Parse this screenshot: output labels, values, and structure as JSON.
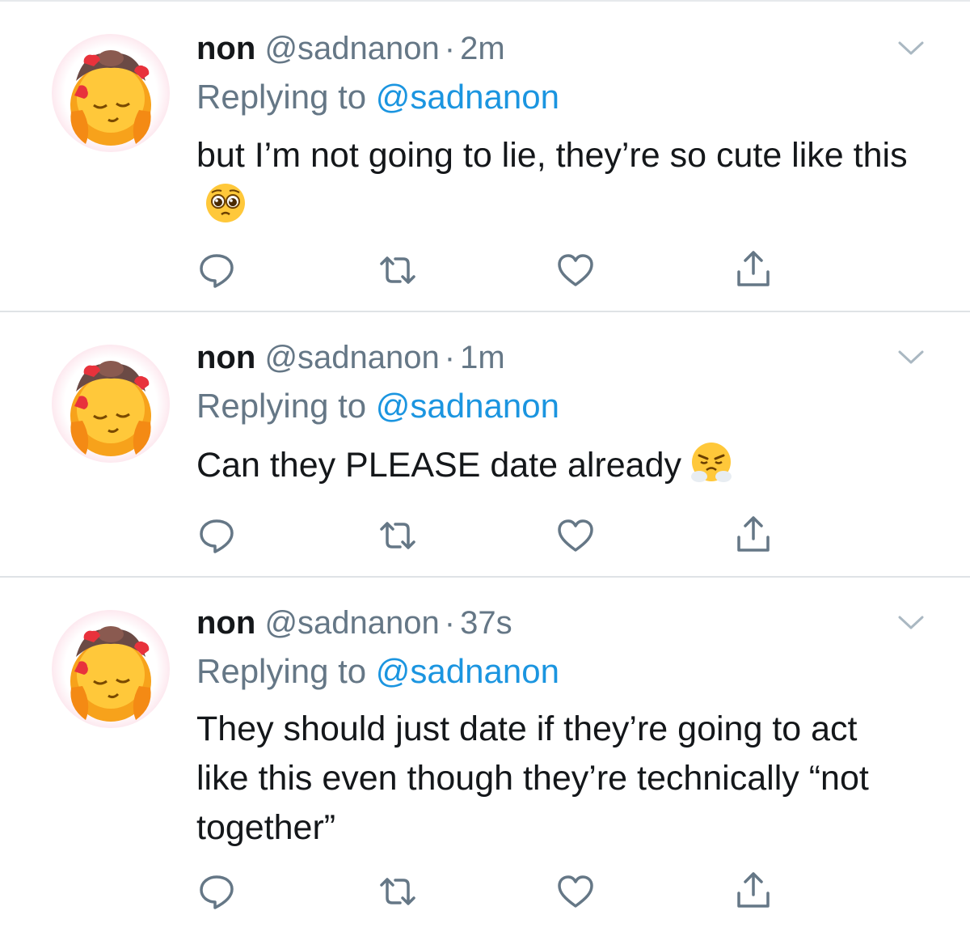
{
  "tweets": [
    {
      "display_name": "non",
      "handle": "@sadnanon",
      "separator": "·",
      "time": "2m",
      "replying_prefix": "Replying to",
      "replying_handle": "@sadnanon",
      "text": "but I’m not going to lie, they’re so cute like this",
      "emoji": "pleading-face-icon"
    },
    {
      "display_name": "non",
      "handle": "@sadnanon",
      "separator": "·",
      "time": "1m",
      "replying_prefix": "Replying to",
      "replying_handle": "@sadnanon",
      "text": "Can they PLEASE date already",
      "emoji": "face-with-steam-icon"
    },
    {
      "display_name": "non",
      "handle": "@sadnanon",
      "separator": "·",
      "time": "37s",
      "replying_prefix": "Replying to",
      "replying_handle": "@sadnanon",
      "text": "They should just date if they’re going to act like this even though they’re technically “not together”",
      "emoji": ""
    }
  ],
  "icons": {
    "reply": "reply-icon",
    "retweet": "retweet-icon",
    "like": "heart-icon",
    "share": "share-icon",
    "more": "chevron-down-icon"
  },
  "colors": {
    "text": "#14171a",
    "muted": "#657786",
    "link": "#1b95e0",
    "divider": "#dfe3e6",
    "icon": "#657786"
  }
}
